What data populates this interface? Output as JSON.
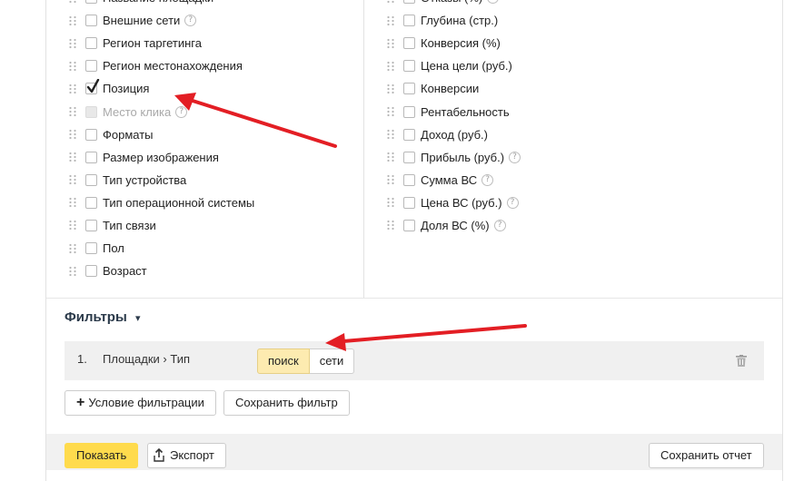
{
  "left_list": [
    {
      "label": "Название площадки",
      "checked": false,
      "disabled": false,
      "help": false
    },
    {
      "label": "Внешние сети",
      "checked": false,
      "disabled": false,
      "help": true
    },
    {
      "label": "Регион таргетинга",
      "checked": false,
      "disabled": false,
      "help": false
    },
    {
      "label": "Регион местонахождения",
      "checked": false,
      "disabled": false,
      "help": false
    },
    {
      "label": "Позиция",
      "checked": true,
      "disabled": false,
      "help": false
    },
    {
      "label": "Место клика",
      "checked": false,
      "disabled": true,
      "help": true
    },
    {
      "label": "Форматы",
      "checked": false,
      "disabled": false,
      "help": false
    },
    {
      "label": "Размер изображения",
      "checked": false,
      "disabled": false,
      "help": false
    },
    {
      "label": "Тип устройства",
      "checked": false,
      "disabled": false,
      "help": false
    },
    {
      "label": "Тип операционной системы",
      "checked": false,
      "disabled": false,
      "help": false
    },
    {
      "label": "Тип связи",
      "checked": false,
      "disabled": false,
      "help": false
    },
    {
      "label": "Пол",
      "checked": false,
      "disabled": false,
      "help": false
    },
    {
      "label": "Возраст",
      "checked": false,
      "disabled": false,
      "help": false
    }
  ],
  "right_list": [
    {
      "label": "Отказы (%)",
      "checked": false,
      "disabled": false,
      "help": true
    },
    {
      "label": "Глубина (стр.)",
      "checked": false,
      "disabled": false,
      "help": false
    },
    {
      "label": "Конверсия (%)",
      "checked": false,
      "disabled": false,
      "help": false
    },
    {
      "label": "Цена цели (руб.)",
      "checked": false,
      "disabled": false,
      "help": false
    },
    {
      "label": "Конверсии",
      "checked": false,
      "disabled": false,
      "help": false
    },
    {
      "label": "Рентабельность",
      "checked": false,
      "disabled": false,
      "help": false
    },
    {
      "label": "Доход (руб.)",
      "checked": false,
      "disabled": false,
      "help": false
    },
    {
      "label": "Прибыль (руб.)",
      "checked": false,
      "disabled": false,
      "help": true
    },
    {
      "label": "Сумма ВС",
      "checked": false,
      "disabled": false,
      "help": true
    },
    {
      "label": "Цена ВС (руб.)",
      "checked": false,
      "disabled": false,
      "help": true
    },
    {
      "label": "Доля ВС (%)",
      "checked": false,
      "disabled": false,
      "help": true
    }
  ],
  "help_glyph": "?",
  "filters": {
    "title": "Фильтры",
    "caret": "▾",
    "rows": [
      {
        "number": "1.",
        "field": "Площадки › Тип",
        "options": [
          "поиск",
          "сети"
        ],
        "selected": "поиск"
      }
    ],
    "add_condition_label": "Условие фильтрации",
    "add_condition_icon": "+",
    "save_filter_label": "Сохранить фильтр"
  },
  "footer": {
    "show_label": "Показать",
    "export_label": "Экспорт",
    "save_report_label": "Сохранить отчет"
  },
  "colors": {
    "primary_button": "#ffdb4d",
    "selected_segment": "#fdebb0",
    "annotation_arrow": "#e31e24",
    "checkmark": "#222222"
  },
  "icons": {
    "drag_handle": "grip-icon",
    "help": "question-circle-icon",
    "checkmark": "checkmark-icon",
    "delete": "trash-icon",
    "export": "upload-icon",
    "plus": "plus-icon"
  }
}
